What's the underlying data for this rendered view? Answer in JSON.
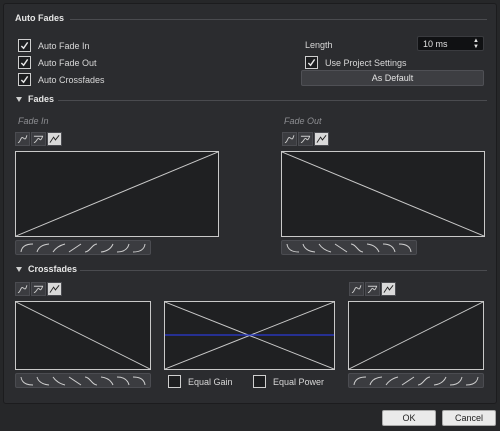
{
  "auto_fades": {
    "title": "Auto Fades",
    "auto_fade_in": {
      "label": "Auto Fade In",
      "checked": true
    },
    "auto_fade_out": {
      "label": "Auto Fade Out",
      "checked": true
    },
    "auto_crossfades": {
      "label": "Auto Crossfades",
      "checked": true
    },
    "length_label": "Length",
    "length_value": "10 ms",
    "use_project_settings": {
      "label": "Use Project Settings",
      "checked": true
    },
    "as_default_label": "As Default"
  },
  "fades": {
    "title": "Fades",
    "fade_in_label": "Fade In",
    "fade_out_label": "Fade Out",
    "curve_mode_icons": [
      "spline-curve-icon",
      "damped-spline-icon",
      "linear-curve-icon"
    ],
    "selected_mode": "linear-curve-icon",
    "fade_in_preset_icons": [
      "curve-preset-icon",
      "curve-preset-icon",
      "curve-preset-icon",
      "curve-preset-icon",
      "curve-preset-icon",
      "curve-preset-icon",
      "curve-preset-icon",
      "curve-preset-icon"
    ],
    "fade_out_preset_icons": [
      "curve-preset-icon",
      "curve-preset-icon",
      "curve-preset-icon",
      "curve-preset-icon",
      "curve-preset-icon",
      "curve-preset-icon",
      "curve-preset-icon",
      "curve-preset-icon"
    ]
  },
  "crossfades": {
    "title": "Crossfades",
    "equal_gain": {
      "label": "Equal Gain",
      "checked": false
    },
    "equal_power": {
      "label": "Equal Power",
      "checked": false
    }
  },
  "footer": {
    "ok_label": "OK",
    "cancel_label": "Cancel"
  },
  "colors": {
    "background": "#262729",
    "panel": "#2b2c2f",
    "graph_line": "#c9c9c9",
    "crossfade_level_line": "#2a3bd6",
    "selected_icon_bg": "#d9d9d9"
  }
}
